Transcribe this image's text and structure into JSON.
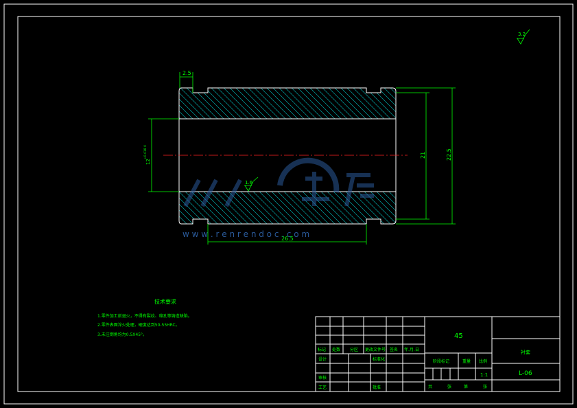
{
  "drawing": {
    "surface_finish_general": "3.2",
    "surface_finish_bore": "1.6",
    "dims": {
      "groove_width": "2.5",
      "bore_dia": "12",
      "bore_tol": "+0.018 0",
      "inner_height": "21",
      "outer_dia": "22.5",
      "length": "26.5"
    },
    "watermark_url": "w w w . r e n r e n d o c . c o m",
    "notes_title": "技术要求",
    "notes": [
      "1.零件加工前退火，不得有裂纹、缩孔等铸造缺陷。",
      "2.零件表面淬火处理，硬度达到50-55HRC。",
      "3.未注倒角均为0.5X45°。"
    ]
  },
  "title_block": {
    "material": "45",
    "part_name": "衬套",
    "drawing_no": "L-06",
    "scale": "1:1",
    "labels": {
      "mark": "标记",
      "count": "处数",
      "zone": "分区",
      "change_doc": "更改文件号",
      "signature": "签名",
      "date": "年.月.日",
      "design": "设计",
      "standardize": "标准化",
      "stage_mark": "阶段标记",
      "weight": "重量",
      "scale": "比例",
      "review": "审核",
      "process": "工艺",
      "approve": "批准",
      "total": "共",
      "sheets": "张",
      "page": "第",
      "sheet": "张"
    }
  }
}
